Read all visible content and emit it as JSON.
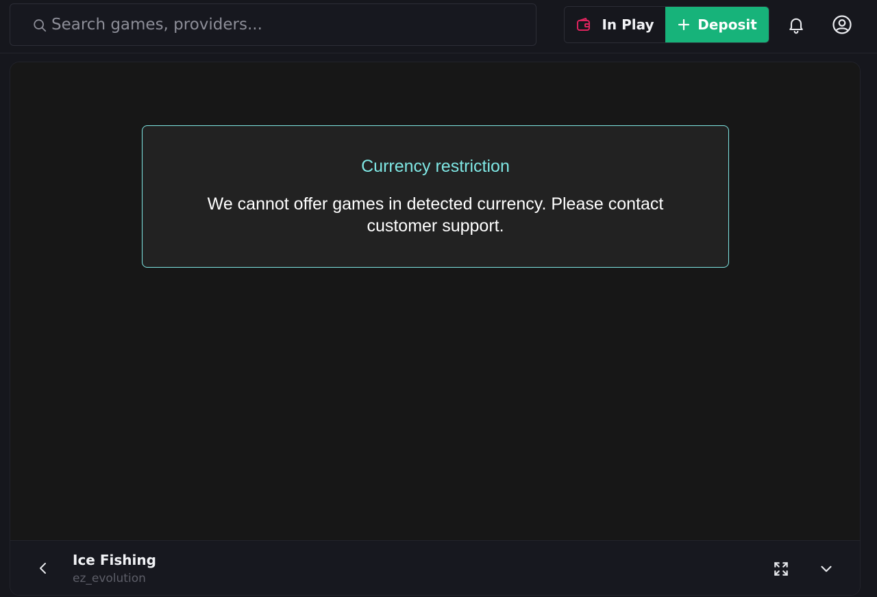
{
  "header": {
    "search": {
      "placeholder": "Search games, providers...",
      "value": ""
    },
    "in_play_label": "In Play",
    "deposit_label": "Deposit",
    "icons": {
      "search": "search-icon",
      "wallet": "wallet-icon",
      "plus": "plus-icon",
      "bell": "bell-icon",
      "user": "user-icon"
    },
    "colors": {
      "deposit": "#17b37a",
      "wallet_icon": "#e0245e"
    }
  },
  "alert": {
    "title": "Currency restriction",
    "message": "We cannot offer games in detected currency. Please contact customer support.",
    "accent": "#7fe7e4"
  },
  "footer": {
    "game_title": "Ice Fishing",
    "provider": "ez_evolution",
    "icons": {
      "back": "chevron-left-icon",
      "expand": "expand-icon",
      "collapse": "chevron-down-icon"
    }
  }
}
